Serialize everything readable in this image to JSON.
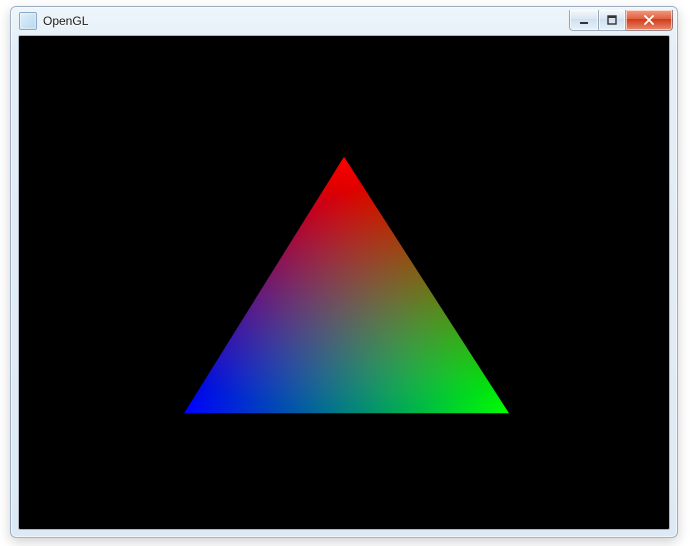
{
  "window": {
    "title": "OpenGL",
    "icon_name": "opengl-app-icon"
  },
  "controls": {
    "minimize_tooltip": "Minimize",
    "maximize_tooltip": "Maximize",
    "close_tooltip": "Close"
  },
  "viewport": {
    "background_color": "#000000",
    "triangle": {
      "vertices": [
        {
          "name": "top",
          "color": "#ff0000"
        },
        {
          "name": "bottom-left",
          "color": "#0000ff"
        },
        {
          "name": "bottom-right",
          "color": "#00ff00"
        }
      ]
    }
  }
}
